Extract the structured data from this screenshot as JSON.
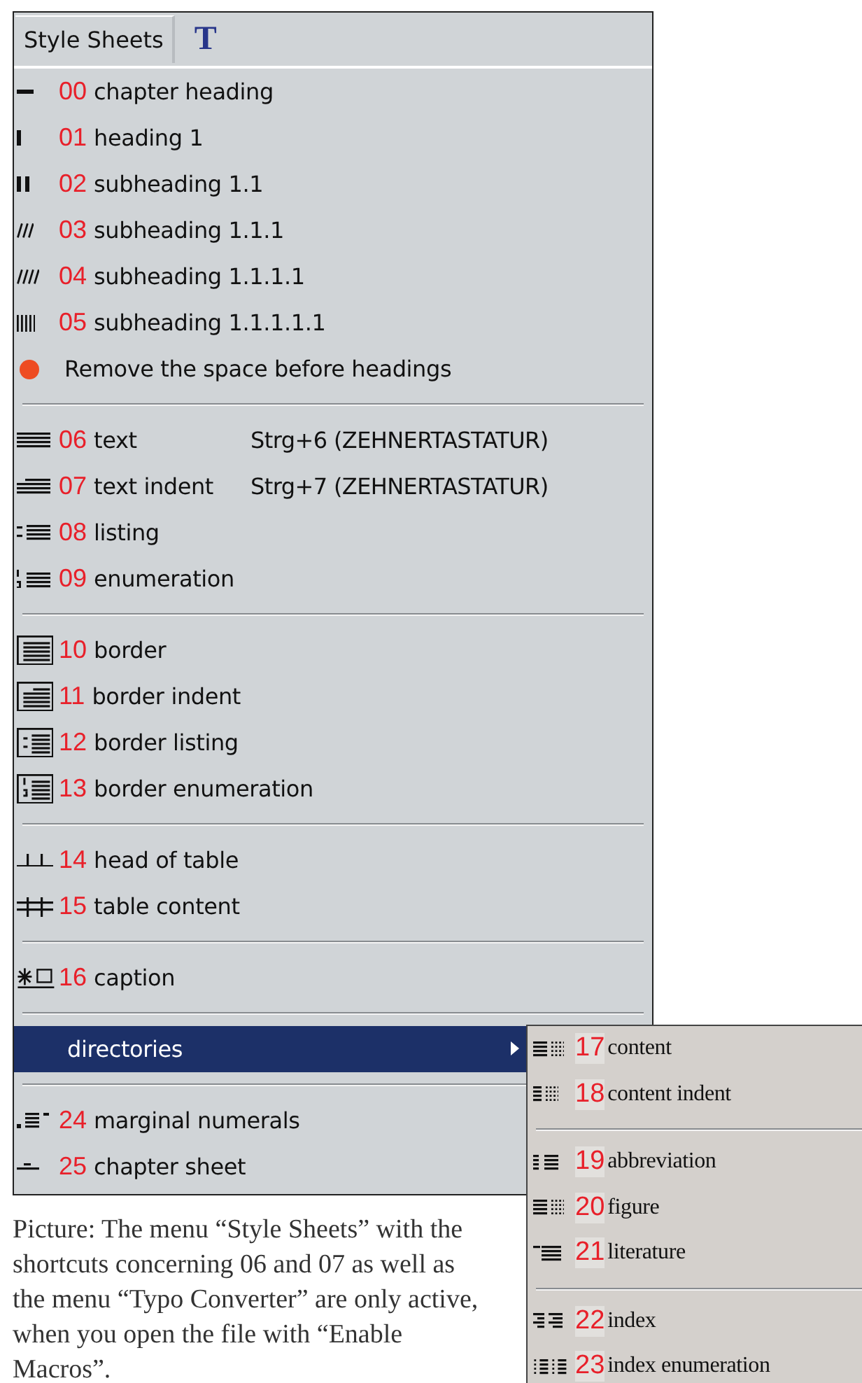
{
  "menu_bar": {
    "tabs": [
      {
        "label": "Style Sheets"
      }
    ],
    "converter_button": "T"
  },
  "menu": {
    "groups": [
      {
        "items": [
          {
            "kind": "style",
            "number": "00",
            "label": "chapter heading"
          },
          {
            "kind": "style",
            "number": "01",
            "label": "heading 1"
          },
          {
            "kind": "style",
            "number": "02",
            "label": "subheading 1.1"
          },
          {
            "kind": "style",
            "number": "03",
            "label": "subheading 1.1.1"
          },
          {
            "kind": "style",
            "number": "04",
            "label": "subheading 1.1.1.1"
          },
          {
            "kind": "style",
            "number": "05",
            "label": "subheading 1.1.1.1.1"
          },
          {
            "kind": "action",
            "label": "Remove the space before headings"
          }
        ]
      },
      {
        "items": [
          {
            "kind": "style",
            "number": "06",
            "label": "text",
            "shortcut": "Strg+6 (ZEHNERTASTATUR)"
          },
          {
            "kind": "style",
            "number": "07",
            "label": "text indent",
            "shortcut": "Strg+7 (ZEHNERTASTATUR)"
          },
          {
            "kind": "style",
            "number": "08",
            "label": "listing"
          },
          {
            "kind": "style",
            "number": "09",
            "label": "enumeration"
          }
        ]
      },
      {
        "items": [
          {
            "kind": "style",
            "number": "10",
            "label": "border"
          },
          {
            "kind": "style",
            "number": "11",
            "label": "border indent"
          },
          {
            "kind": "style",
            "number": "12",
            "label": "border listing"
          },
          {
            "kind": "style",
            "number": "13",
            "label": "border enumeration"
          }
        ]
      },
      {
        "items": [
          {
            "kind": "style",
            "number": "14",
            "label": "head of table"
          },
          {
            "kind": "style",
            "number": "15",
            "label": "table content"
          }
        ]
      },
      {
        "items": [
          {
            "kind": "style",
            "number": "16",
            "label": "caption"
          }
        ]
      },
      {
        "items": [
          {
            "kind": "submenu",
            "label": "directories",
            "selected": true,
            "submenu": {
              "groups": [
                {
                  "items": [
                    {
                      "kind": "style",
                      "number": "17",
                      "label": "content"
                    },
                    {
                      "kind": "style",
                      "number": "18",
                      "label": "content indent"
                    }
                  ]
                },
                {
                  "items": [
                    {
                      "kind": "style",
                      "number": "19",
                      "label": "abbreviation"
                    },
                    {
                      "kind": "style",
                      "number": "20",
                      "label": "figure"
                    },
                    {
                      "kind": "style",
                      "number": "21",
                      "label": "literature"
                    }
                  ]
                },
                {
                  "items": [
                    {
                      "kind": "style",
                      "number": "22",
                      "label": "index"
                    },
                    {
                      "kind": "style",
                      "number": "23",
                      "label": "index enumeration"
                    }
                  ]
                }
              ]
            }
          }
        ]
      },
      {
        "items": [
          {
            "kind": "style",
            "number": "24",
            "label": "marginal numerals"
          },
          {
            "kind": "style",
            "number": "25",
            "label": "chapter sheet"
          }
        ]
      }
    ]
  },
  "caption": "Picture: The menu “Style Sheets” with the shortcuts concerning 06 and 07 as well as the menu “Typo Converter” are only active, when you open the file with “Enable Macros”."
}
